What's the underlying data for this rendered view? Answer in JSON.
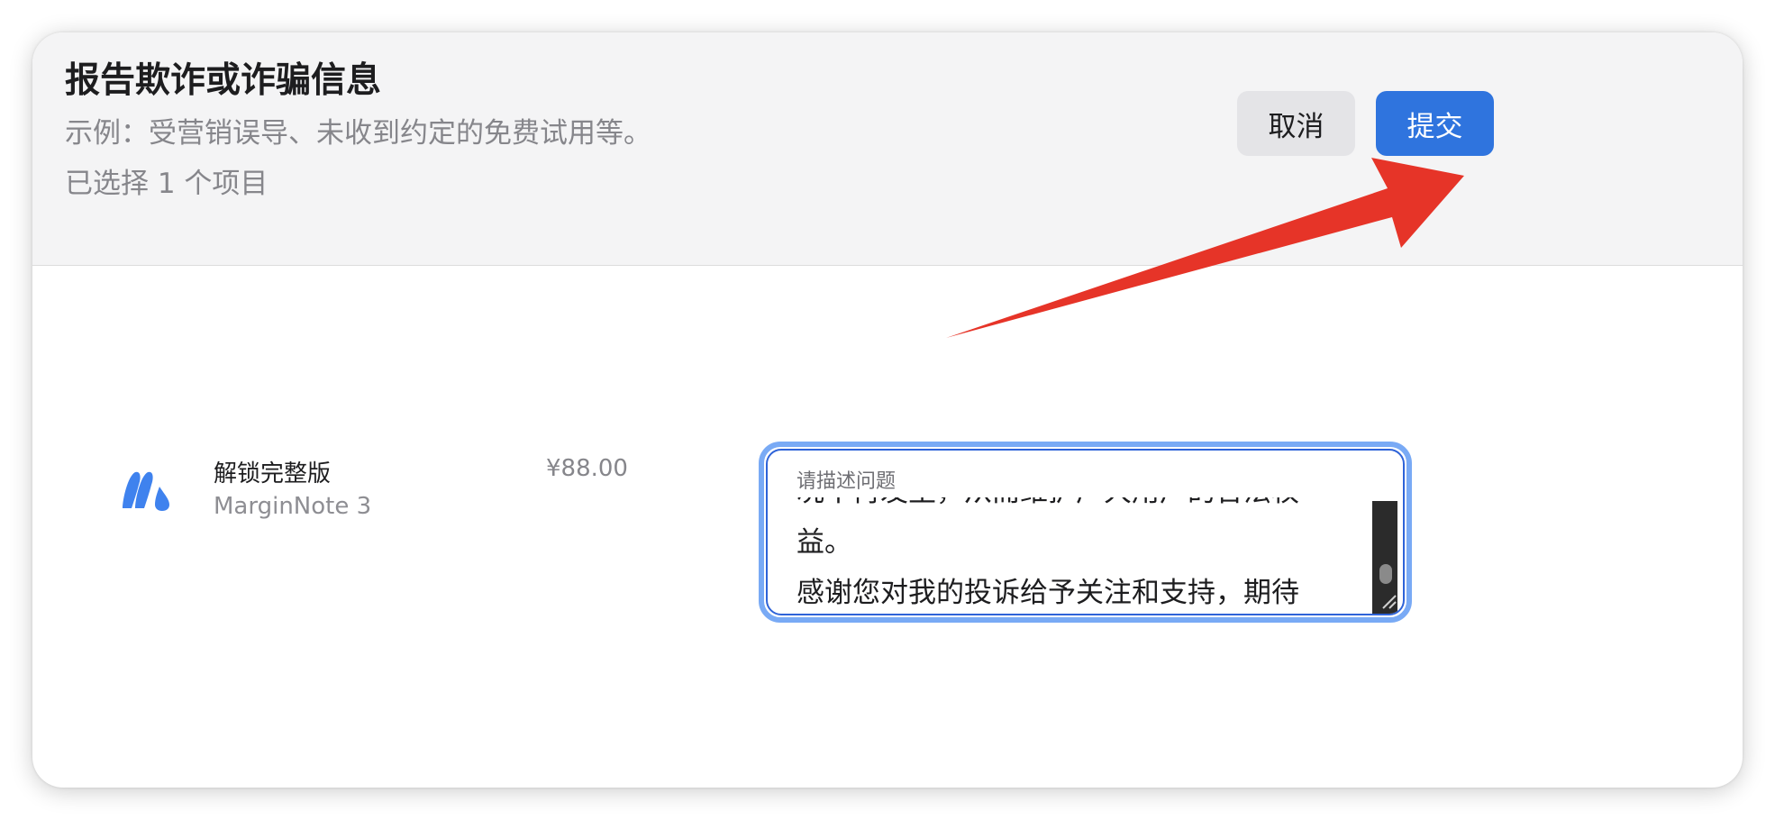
{
  "dialog": {
    "title": "报告欺诈或诈骗信息",
    "subtitle": "示例：受营销误导、未收到约定的免费试用等。",
    "selected_count": "已选择 1 个项目",
    "cancel_label": "取消",
    "submit_label": "提交"
  },
  "item": {
    "name": "解锁完整版",
    "app": "MarginNote 3",
    "price": "¥88.00",
    "icon": "marginnote-app-icon"
  },
  "textarea": {
    "label": "请描述问题",
    "lines": [
      "况不再发生，从而维护广大用户的合法权",
      "益。",
      "感谢您对我的投诉给予关注和支持，期待"
    ]
  },
  "annotation": {
    "arrow_color": "#e63428",
    "arrow_target": "submit-button"
  },
  "colors": {
    "accent": "#2f74de",
    "focus_ring": "#79aaf5"
  }
}
